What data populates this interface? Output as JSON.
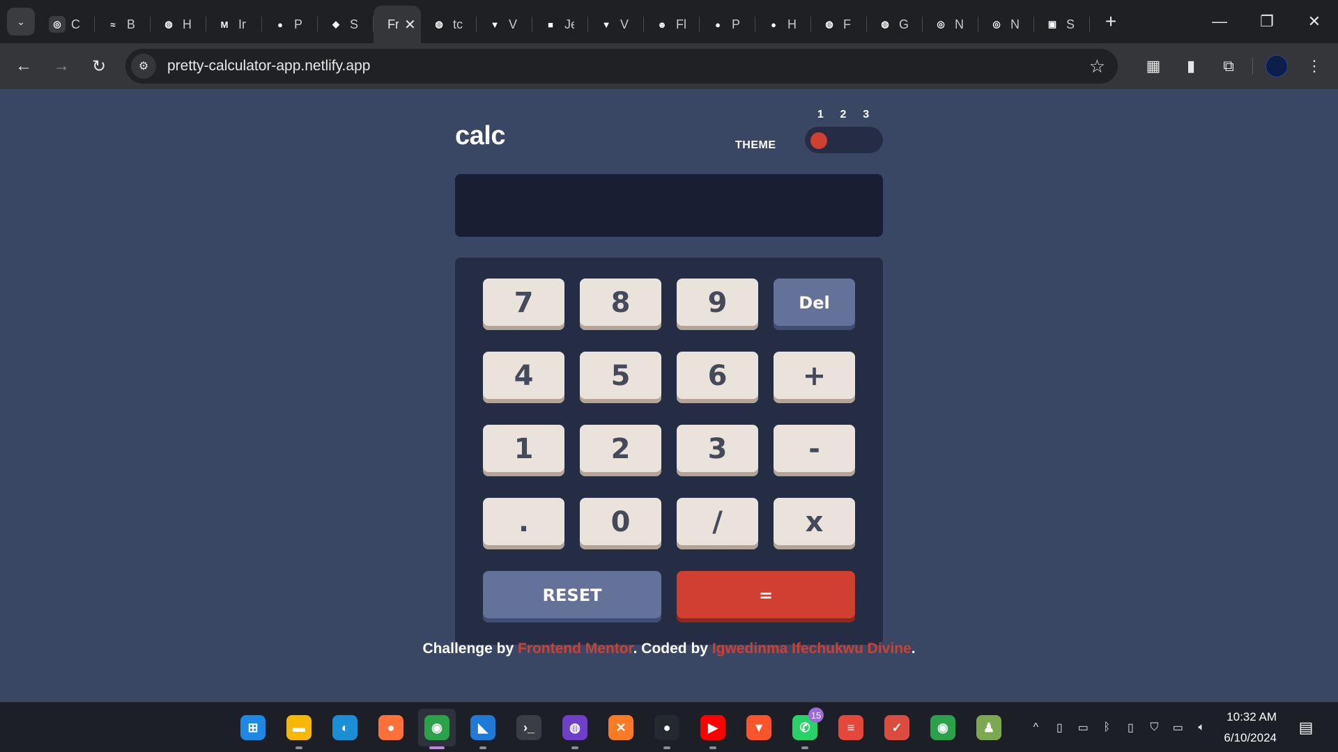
{
  "browser": {
    "tabs": [
      {
        "title": "C",
        "icon": "openai-icon",
        "color": "#3b3c40",
        "glyph": "◎"
      },
      {
        "title": "B",
        "icon": "tailwind-icon",
        "color": "#1f2023",
        "glyph": "≈"
      },
      {
        "title": "H",
        "icon": "globe-icon",
        "color": "#1f2023",
        "glyph": "◍"
      },
      {
        "title": "Ir",
        "icon": "medium-icon",
        "color": "#1f2023",
        "glyph": "M"
      },
      {
        "title": "P",
        "icon": "panda-icon",
        "color": "#1f2023",
        "glyph": "●"
      },
      {
        "title": "S",
        "icon": "diamond-icon",
        "color": "#1f2023",
        "glyph": "◆"
      },
      {
        "title": "Fr",
        "icon": "none",
        "color": "#35363a",
        "glyph": "",
        "active": true
      },
      {
        "title": "tc",
        "icon": "globe-icon",
        "color": "#1f2023",
        "glyph": "◍"
      },
      {
        "title": "V",
        "icon": "vite-icon",
        "color": "#1f2023",
        "glyph": "▼"
      },
      {
        "title": "Je",
        "icon": "portrait-icon",
        "color": "#1f2023",
        "glyph": "■"
      },
      {
        "title": "V",
        "icon": "vite-icon",
        "color": "#1f2023",
        "glyph": "▼"
      },
      {
        "title": "Fl",
        "icon": "frog-icon",
        "color": "#1f2023",
        "glyph": "☻"
      },
      {
        "title": "P",
        "icon": "panda-icon",
        "color": "#1f2023",
        "glyph": "●"
      },
      {
        "title": "H",
        "icon": "medium-icon",
        "color": "#1f2023",
        "glyph": "●"
      },
      {
        "title": "F",
        "icon": "globe-icon",
        "color": "#1f2023",
        "glyph": "◍"
      },
      {
        "title": "G",
        "icon": "globe-icon",
        "color": "#1f2023",
        "glyph": "◍"
      },
      {
        "title": "N",
        "icon": "openai-icon",
        "color": "#1f2023",
        "glyph": "◎"
      },
      {
        "title": "N",
        "icon": "openai-icon",
        "color": "#1f2023",
        "glyph": "◎"
      },
      {
        "title": "S",
        "icon": "sojiro-icon",
        "color": "#1f2023",
        "glyph": "▣"
      }
    ],
    "active_tab_close": "✕",
    "new_tab": "+",
    "window_controls": {
      "minimize": "—",
      "restore": "❐",
      "close": "✕"
    },
    "nav": {
      "back": "←",
      "forward": "→",
      "reload": "↻"
    },
    "url": "pretty-calculator-app.netlify.app",
    "site_info_glyph": "⚙",
    "bookmark_glyph": "☆",
    "toolbar_icons": [
      {
        "name": "qr-code-icon",
        "glyph": "▦"
      },
      {
        "name": "clipboard-extension-icon",
        "glyph": "▮"
      },
      {
        "name": "extensions-icon",
        "glyph": "⧉"
      }
    ],
    "menu_glyph": "⋮"
  },
  "calculator": {
    "logo": "calc",
    "theme_label": "THEME",
    "theme_numbers": [
      "1",
      "2",
      "3"
    ],
    "theme_selected": 1,
    "screen_value": "",
    "keys": [
      {
        "label": "7",
        "name": "key-7",
        "type": "num"
      },
      {
        "label": "8",
        "name": "key-8",
        "type": "num"
      },
      {
        "label": "9",
        "name": "key-9",
        "type": "num"
      },
      {
        "label": "Del",
        "name": "key-del",
        "type": "del"
      },
      {
        "label": "4",
        "name": "key-4",
        "type": "num"
      },
      {
        "label": "5",
        "name": "key-5",
        "type": "num"
      },
      {
        "label": "6",
        "name": "key-6",
        "type": "num"
      },
      {
        "label": "+",
        "name": "key-plus",
        "type": "num"
      },
      {
        "label": "1",
        "name": "key-1",
        "type": "num"
      },
      {
        "label": "2",
        "name": "key-2",
        "type": "num"
      },
      {
        "label": "3",
        "name": "key-3",
        "type": "num"
      },
      {
        "label": "-",
        "name": "key-minus",
        "type": "num"
      },
      {
        "label": ".",
        "name": "key-decimal",
        "type": "num"
      },
      {
        "label": "0",
        "name": "key-0",
        "type": "num"
      },
      {
        "label": "/",
        "name": "key-divide",
        "type": "num"
      },
      {
        "label": "x",
        "name": "key-multiply",
        "type": "num"
      }
    ],
    "reset_label": "RESET",
    "equals_label": "=",
    "colors": {
      "page_bg": "#3a4764",
      "keypad_bg": "#242d44",
      "screen_bg": "#181f33",
      "key_bg": "#eae3dc",
      "key_fn_bg": "#647198",
      "key_equals_bg": "#d03f2f"
    }
  },
  "attribution": {
    "prefix": "Challenge by ",
    "link1": "Frontend Mentor",
    "middle": ". Coded by ",
    "link2": "Igwedinma Ifechukwu Divine",
    "suffix": "."
  },
  "taskbar": {
    "apps": [
      {
        "name": "windows-start-icon",
        "glyph": "⊞",
        "color": "#1e88e5",
        "running": false
      },
      {
        "name": "file-explorer-icon",
        "glyph": "▬",
        "color": "#f6b800",
        "running": true
      },
      {
        "name": "edge-icon",
        "glyph": "◐",
        "color": "#1a8fd6",
        "running": false
      },
      {
        "name": "firefox-icon",
        "glyph": "●",
        "color": "#ff7139",
        "running": false
      },
      {
        "name": "chrome-icon",
        "glyph": "◉",
        "color": "#2aa24a",
        "running": true,
        "active": true
      },
      {
        "name": "vscode-icon",
        "glyph": "◣",
        "color": "#1e7ad6",
        "running": true
      },
      {
        "name": "terminal-icon",
        "glyph": "›_",
        "color": "#3a3d45",
        "running": false
      },
      {
        "name": "github-desktop-icon",
        "glyph": "◍",
        "color": "#6e40c9",
        "running": true
      },
      {
        "name": "xampp-icon",
        "glyph": "✕",
        "color": "#fb7a24",
        "running": false
      },
      {
        "name": "github-icon",
        "glyph": "●",
        "color": "#24292f",
        "running": true
      },
      {
        "name": "youtube-icon",
        "glyph": "▶",
        "color": "#ff0000",
        "running": true
      },
      {
        "name": "brave-icon",
        "glyph": "▼",
        "color": "#fb542b",
        "running": false
      },
      {
        "name": "whatsapp-icon",
        "glyph": "✆",
        "color": "#25d366",
        "running": true,
        "badge": "15"
      },
      {
        "name": "stacks-icon",
        "glyph": "≡",
        "color": "#e5483b",
        "running": false
      },
      {
        "name": "todo-icon",
        "glyph": "✓",
        "color": "#db4c3f",
        "running": false
      },
      {
        "name": "chrome-alt-icon",
        "glyph": "◉",
        "color": "#2aa24a",
        "running": false
      },
      {
        "name": "chess-icon",
        "glyph": "♟",
        "color": "#7ca94f",
        "running": false
      }
    ],
    "tray": [
      {
        "name": "show-hidden-icons",
        "glyph": "^"
      },
      {
        "name": "microphone-icon",
        "glyph": "▯"
      },
      {
        "name": "network-display-icon",
        "glyph": "▭"
      },
      {
        "name": "bluetooth-icon",
        "glyph": "ᛒ"
      },
      {
        "name": "usb-icon",
        "glyph": "▯"
      },
      {
        "name": "security-warning-icon",
        "glyph": "⛉"
      },
      {
        "name": "battery-icon",
        "glyph": "▭"
      },
      {
        "name": "volume-icon",
        "glyph": "🔈︎"
      }
    ],
    "time": "10:32 AM",
    "date": "6/10/2024",
    "notification_glyph": "▤"
  }
}
